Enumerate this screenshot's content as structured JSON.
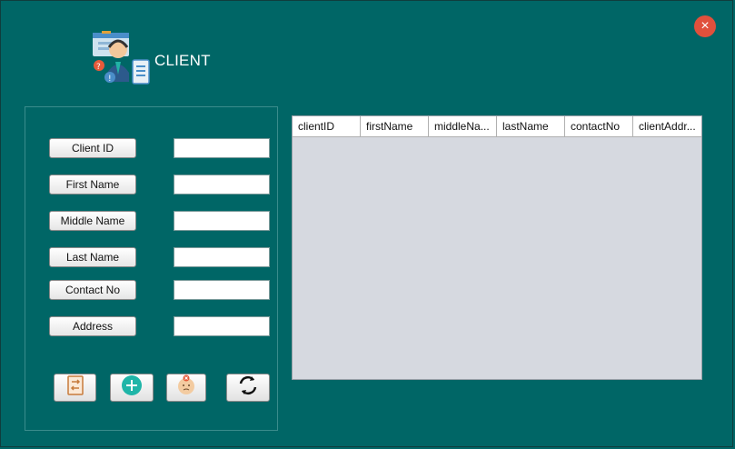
{
  "window": {
    "title": "CLIENT",
    "close_icon": "×"
  },
  "form": {
    "fields": [
      {
        "label": "Client ID",
        "value": ""
      },
      {
        "label": "First Name",
        "value": ""
      },
      {
        "label": "Middle Name",
        "value": ""
      },
      {
        "label": "Last Name",
        "value": ""
      },
      {
        "label": "Contact No",
        "value": ""
      },
      {
        "label": "Address",
        "value": ""
      }
    ],
    "actions": [
      "update-icon",
      "add-icon",
      "delete-icon",
      "refresh-icon"
    ]
  },
  "table": {
    "columns": [
      "clientID",
      "firstName",
      "middleNa...",
      "lastName",
      "contactNo",
      "clientAddr..."
    ],
    "rows": []
  },
  "colors": {
    "background": "#006666",
    "table_bg": "#d6d9e0",
    "close": "#e0503c",
    "add": "#1fb5a8"
  }
}
